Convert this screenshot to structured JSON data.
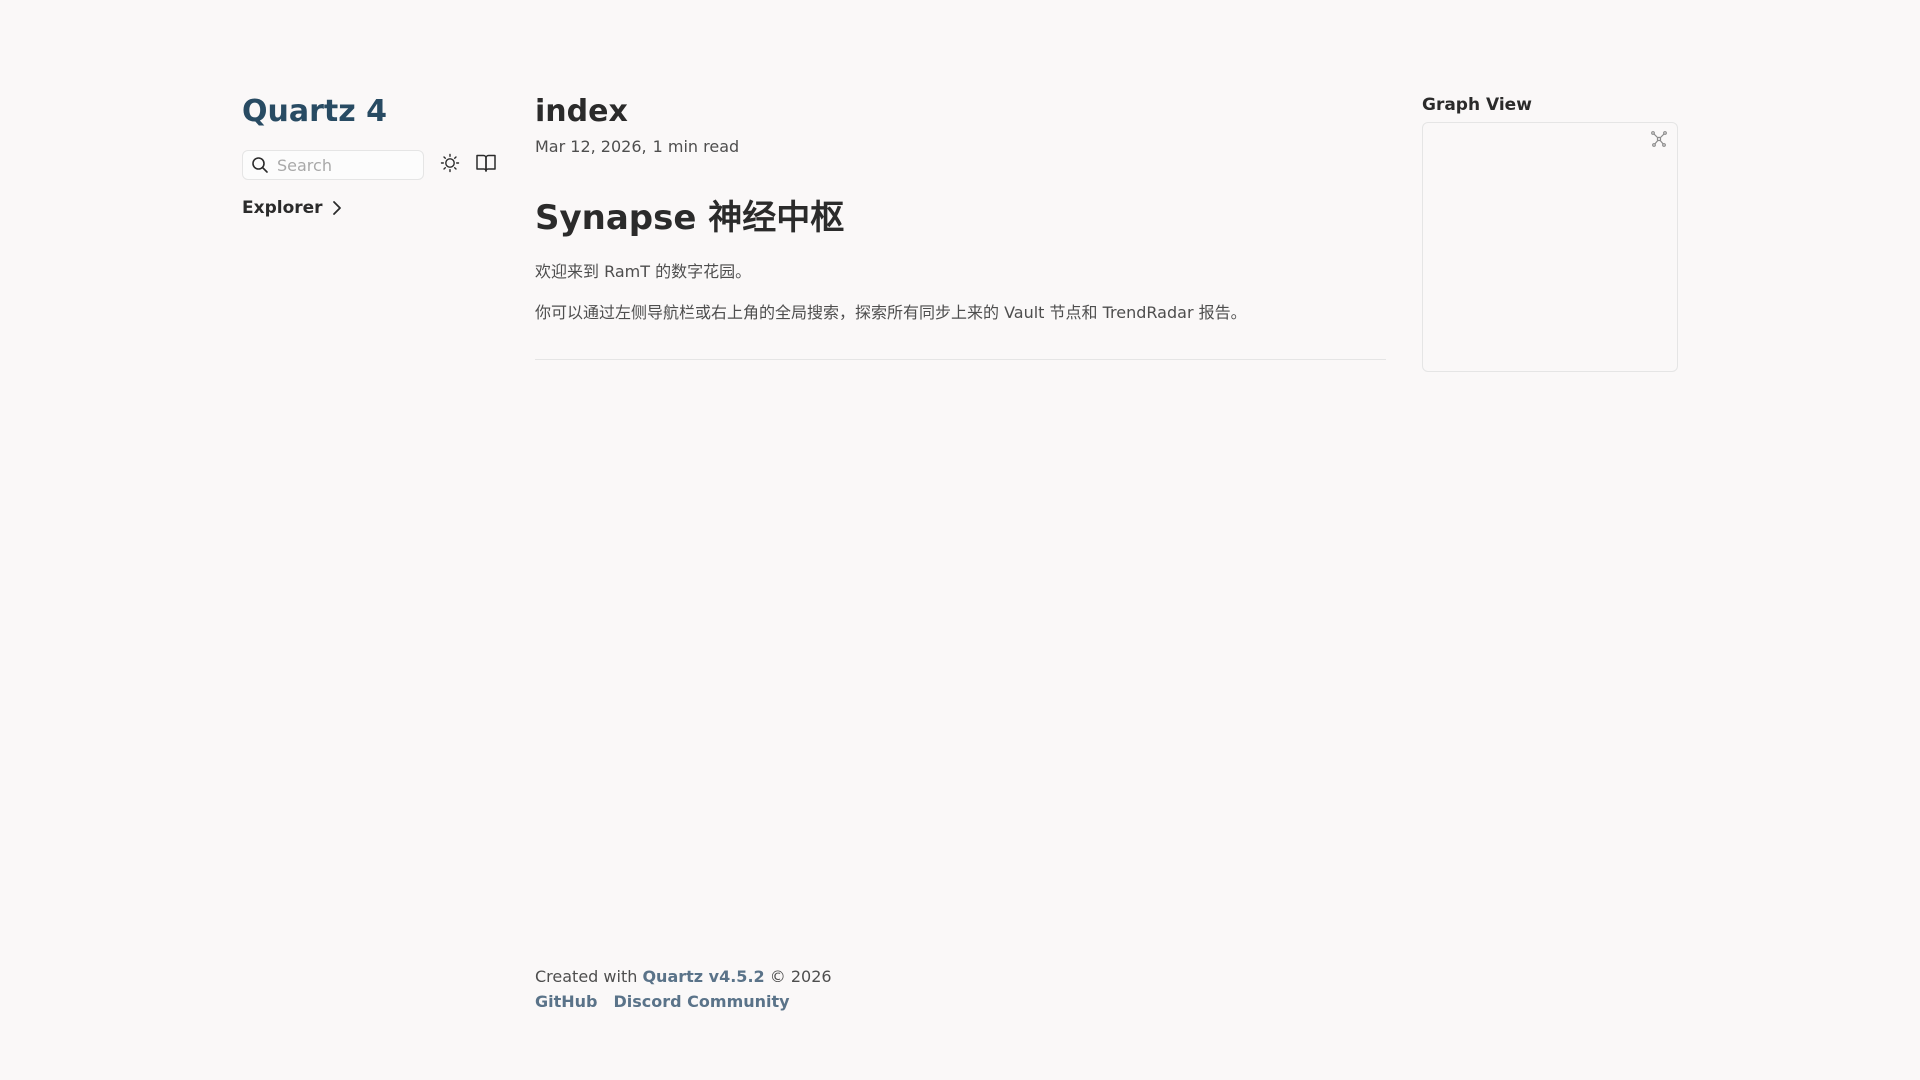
{
  "sidebar": {
    "site_title": "Quartz 4",
    "search": {
      "placeholder": "Search",
      "icon": "search-icon"
    },
    "theme_toggle_icon": "sun-icon",
    "reader_mode_icon": "book-icon",
    "explorer": {
      "label": "Explorer",
      "icon": "chevron-right-icon"
    }
  },
  "content": {
    "title": "index",
    "meta": {
      "date": "Mar 12, 2026",
      "separator": ",",
      "read_time": "1 min read"
    },
    "heading": "Synapse 神经中枢",
    "paragraphs": [
      "欢迎来到 RamT 的数字花园。",
      "你可以通过左侧导航栏或右上角的全局搜索，探索所有同步上来的 Vault 节点和 TrendRadar 报告。"
    ]
  },
  "graph": {
    "title": "Graph View",
    "expand_icon": "global-graph-icon"
  },
  "footer": {
    "created_prefix": "Created with",
    "brand": "Quartz v4.5.2",
    "copyright": "© 2026",
    "links": [
      "GitHub",
      "Discord Community"
    ]
  },
  "colors": {
    "background": "#faf8f8",
    "title": "#284b63",
    "link": "#5a7389",
    "text": "#2b2b2b",
    "muted": "#4e4e4e",
    "border": "#e5e5e5"
  }
}
